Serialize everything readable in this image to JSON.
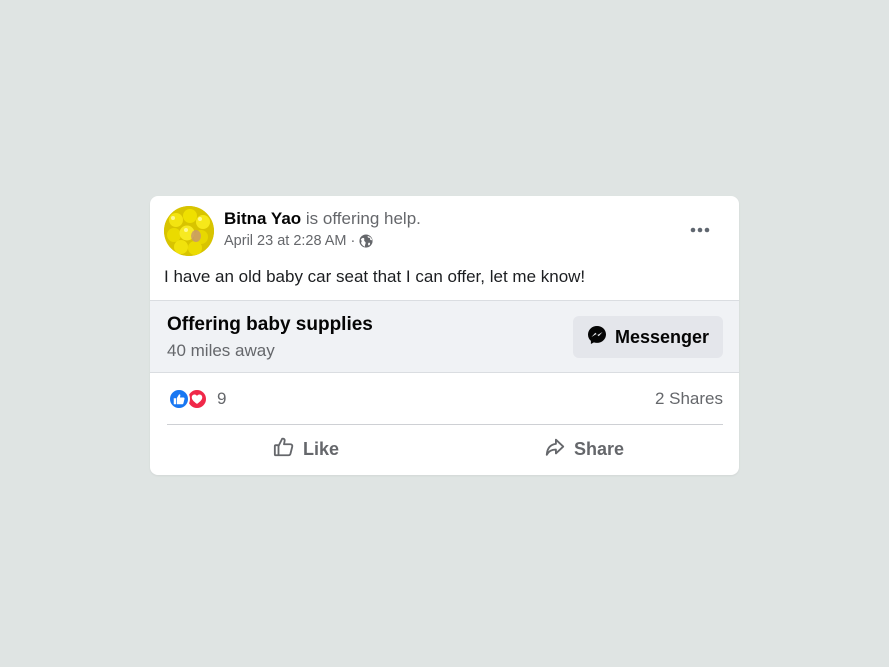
{
  "post": {
    "author": "Bitna Yao",
    "action": "is offering help.",
    "timestamp": "April 23 at 2:28 AM",
    "separator": "·",
    "privacy_icon": "globe-icon",
    "text": "I have an old baby car seat that I can offer, let me know!"
  },
  "help_card": {
    "title": "Offering baby supplies",
    "distance": "40 miles away",
    "button_label": "Messenger",
    "button_icon": "messenger-icon"
  },
  "stats": {
    "reaction_icons": [
      "like-reaction-icon",
      "love-reaction-icon"
    ],
    "reaction_count": "9",
    "shares": "2 Shares"
  },
  "actions": {
    "like_label": "Like",
    "share_label": "Share"
  },
  "colors": {
    "background": "#dfe4e3",
    "card": "#ffffff",
    "panel": "#f0f2f5",
    "like_blue": "#1877f2",
    "love_red": "#f02849",
    "secondary_text": "#65676b"
  }
}
